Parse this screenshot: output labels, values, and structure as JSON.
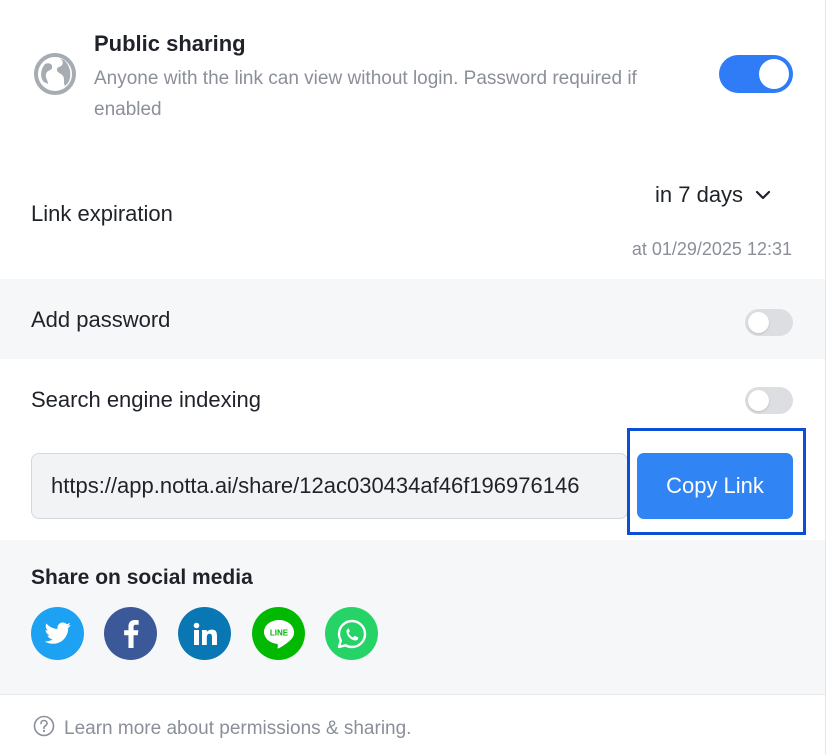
{
  "public_sharing": {
    "title": "Public sharing",
    "description": "Anyone with the link can view without login. Password required if enabled",
    "enabled": true,
    "icon": "globe-icon"
  },
  "link_expiration": {
    "label": "Link expiration",
    "selected": "in 7 days",
    "expires_at": "at 01/29/2025 12:31"
  },
  "add_password": {
    "label": "Add password",
    "enabled": false
  },
  "search_indexing": {
    "label": "Search engine indexing",
    "enabled": false
  },
  "share_link": {
    "url": "https://app.notta.ai/share/12ac030434af46f196976146",
    "copy_label": "Copy Link"
  },
  "social": {
    "title": "Share on social media",
    "networks": [
      "twitter-icon",
      "facebook-icon",
      "linkedin-icon",
      "line-icon",
      "whatsapp-icon"
    ]
  },
  "footer": {
    "help_text": "Learn more about permissions & sharing."
  },
  "colors": {
    "accent": "#3184f4",
    "toggle_on": "#2f7cf6",
    "focus_frame": "#0b4fd4"
  }
}
